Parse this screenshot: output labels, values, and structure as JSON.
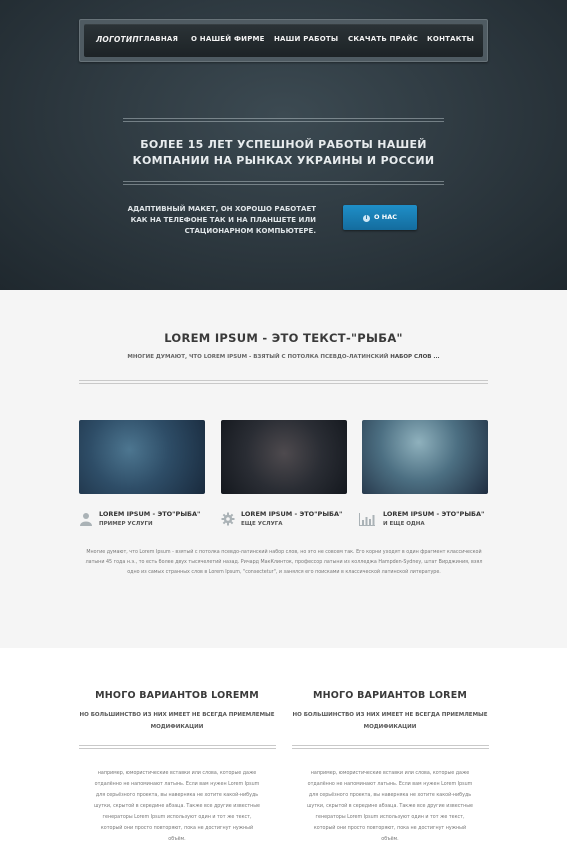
{
  "nav": {
    "logo": "ЛОГОТИП",
    "items": [
      "ГЛАВНАЯ",
      "О НАШЕЙ ФИРМЕ",
      "НАШИ РАБОТЫ",
      "СКАЧАТЬ ПРАЙС",
      "КОНТАКТЫ"
    ]
  },
  "hero": {
    "title": "БОЛЕЕ 15 ЛЕТ УСПЕШНОЙ РАБОТЫ НАШЕЙ КОМПАНИИ НА РЫНКАХ УКРАИНЫ И РОССИИ",
    "subtitle": "АДАПТИВНЫЙ МАКЕТ, ОН ХОРОШО РАБОТАЕТ КАК НА ТЕЛЕФОНЕ ТАК И НА ПЛАНШЕТЕ ИЛИ СТАЦИОНАРНОМ КОМПЬЮТЕРЕ.",
    "button_label": "О НАС",
    "button_icon": "info-icon"
  },
  "section2": {
    "title": "LOREM IPSUM - ЭТО ТЕКСТ-\"РЫБА\"",
    "subtitle_main": "МНОГИЕ ДУМАЮТ, ЧТО LOREM IPSUM - ВЗЯТЫЙ С ПОТОЛКА ПСЕВДО-ЛАТИНСКИЙ ",
    "subtitle_bold": "НАБОР СЛОВ ...",
    "features": [
      {
        "title": "LOREM IPSUM - ЭТО\"РЫБА\"",
        "subtitle": "ПРИМЕР УСЛУГИ",
        "icon": "user-icon"
      },
      {
        "title": "LOREM IPSUM - ЭТО\"РЫБА\"",
        "subtitle": "ЕЩЕ УСЛУГА",
        "icon": "gear-icon"
      },
      {
        "title": "LOREM IPSUM - ЭТО\"РЫБА\"",
        "subtitle": "И ЕЩЕ ОДНА",
        "icon": "bar-chart-icon"
      }
    ],
    "paragraph": "Многие думают, что Lorem Ipsum - взятый с потолка псевдо-латинский набор слов, но это не совсем так. Его корни уходят в один фрагмент классической латыни 45 года н.э., то есть более двух тысячелетий назад. Ричард МакКлинток, профессор латыни из колледжа Hampden-Sydney, штат Вирджиния, взял одно из самых странных слов в Lorem Ipsum, \"consectetur\", и занялся его поисками в классической латинской литературе."
  },
  "section3": {
    "columns": [
      {
        "title": "МНОГО ВАРИАНТОВ LOREMM",
        "subtitle": "НО БОЛЬШИНСТВО ИЗ НИХ ИМЕЕТ НЕ ВСЕГДА ПРИЕМЛЕМЫЕ МОДИФИКАЦИИ",
        "text": "например, юмористические вставки или слова, которые даже отдалённо не напоминают латынь. Если вам нужен Lorem Ipsum для серьёзного проекта, вы наверняка не хотите какой-нибудь шутки, скрытой в середине абзаца. Также все другие известные генераторы Lorem Ipsum используют один и тот же текст, который они просто повторяют, пока не достигнут нужный объём."
      },
      {
        "title": "МНОГО ВАРИАНТОВ LOREM",
        "subtitle": "НО БОЛЬШИНСТВО ИЗ НИХ ИМЕЕТ НЕ ВСЕГДА ПРИЕМЛЕМЫЕ МОДИФИКАЦИИ",
        "text": "например, юмористические вставки или слова, которые даже отдалённо не напоминают латынь. Если вам нужен Lorem Ipsum для серьёзного проекта, вы наверняка не хотите какой-нибудь шутки, скрытой в середине абзаца. Также все другие известные генераторы Lorem Ipsum используют один и тот же текст, который они просто повторяют, пока не достигнут нужный объём."
      }
    ]
  },
  "colors": {
    "accent": "#1a7fb5",
    "hero_bg": "#2c373e",
    "nav_bg": "#1f2528"
  }
}
